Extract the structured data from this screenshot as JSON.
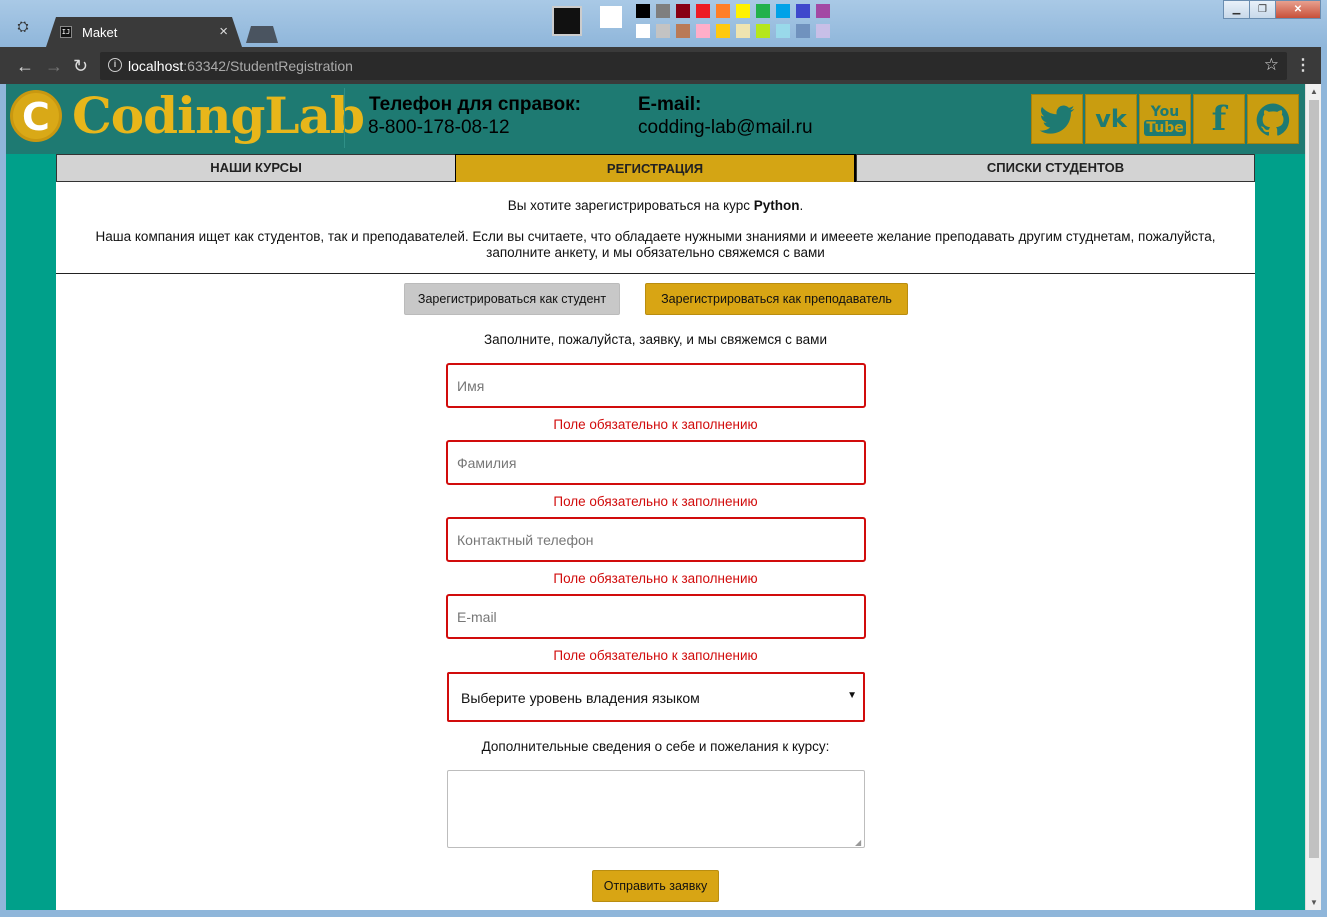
{
  "browser": {
    "tab_title": "Maket",
    "tab_close": "×",
    "url_host": "localhost",
    "url_rest": ":63342/StudentRegistration"
  },
  "header": {
    "logo_letter": "C",
    "logo_text": "CodingLab",
    "phone_label": "Телефон для справок:",
    "phone_value": "8-800-178-08-12",
    "email_label": "E-mail:",
    "email_value": "codding-lab@mail.ru",
    "social": [
      {
        "name": "twitter",
        "glyph": "🐦"
      },
      {
        "name": "vk",
        "glyph": "VK"
      },
      {
        "name": "youtube",
        "glyph": "You Tube"
      },
      {
        "name": "facebook",
        "glyph": "f"
      },
      {
        "name": "github",
        "glyph": "◯"
      }
    ]
  },
  "nav": {
    "courses": "НАШИ КУРСЫ",
    "registration": "РЕГИСТРАЦИЯ",
    "students": "СПИСКИ СТУДЕНТОВ"
  },
  "main": {
    "intro_prefix": "Вы хотите зарегистрироваться на курс ",
    "course_name": "Python",
    "intro_suffix": ".",
    "company_text": "Наша компания ищет как студентов, так и преподавателей. Если вы считаете, что обладаете нужными знаниями и имееете желание преподавать другим студнетам, пожалуйста, заполните анкету, и мы обязательно свяжемся с вами",
    "btn_student": "Зарегистрироваться как студент",
    "btn_teacher": "Зарегистрироваться как преподаватель",
    "fill_hint": "Заполните, пожалуйста, заявку, и мы свяжемся с вами",
    "fields": {
      "first_name": "Имя",
      "last_name": "Фамилия",
      "phone": "Контактный телефон",
      "email": "E-mail"
    },
    "required_error": "Поле обязательно к заполнению",
    "level_select": "Выберите уровень владения языком",
    "extra_label": "Дополнительные сведения о себе и пожелания к курсу:",
    "submit": "Отправить заявку"
  },
  "colors": {
    "teal": "#00a08a",
    "header": "#1e7a72",
    "accent": "#d4a514",
    "error": "#d10c0c"
  }
}
